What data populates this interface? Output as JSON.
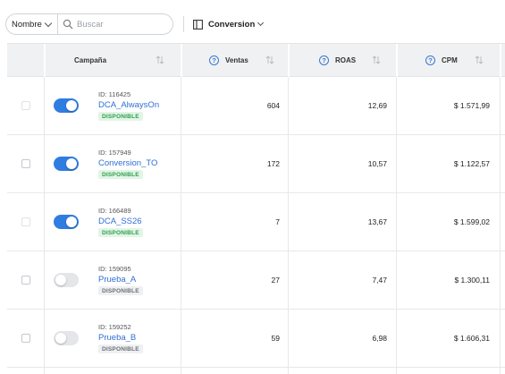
{
  "toolbar": {
    "field_select": "Nombre",
    "search_placeholder": "Buscar",
    "columns_label": "Conversion"
  },
  "table": {
    "headers": {
      "campaign": "Campaña",
      "sales": "Ventas",
      "roas": "ROAS",
      "cpm": "CPM"
    },
    "rows": [
      {
        "id": "ID: 116425",
        "name": "DCA_AlwaysOn",
        "status": "DISPONIBLE",
        "active": true,
        "sales": "604",
        "roas": "12,69",
        "cpm": "$ 1.571,99"
      },
      {
        "id": "ID: 157949",
        "name": "Conversion_TO",
        "status": "DISPONIBLE",
        "active": true,
        "sales": "172",
        "roas": "10,57",
        "cpm": "$ 1.122,57"
      },
      {
        "id": "ID: 166489",
        "name": "DCA_SS26",
        "status": "DISPONIBLE",
        "active": true,
        "sales": "7",
        "roas": "13,67",
        "cpm": "$ 1.599,02"
      },
      {
        "id": "ID: 159095",
        "name": "Prueba_A",
        "status": "DISPONIBLE",
        "active": false,
        "sales": "27",
        "roas": "7,47",
        "cpm": "$ 1.300,11"
      },
      {
        "id": "ID: 159252",
        "name": "Prueba_B",
        "status": "DISPONIBLE",
        "active": false,
        "sales": "59",
        "roas": "6,98",
        "cpm": "$ 1.606,31"
      }
    ]
  },
  "colors": {
    "accent": "#2f7de1",
    "link": "#2f6fd6",
    "badge_active_bg": "#e2f5e6",
    "badge_active_text": "#2e9e4c",
    "badge_inactive_bg": "#eef0f2",
    "badge_inactive_text": "#6b7077"
  }
}
